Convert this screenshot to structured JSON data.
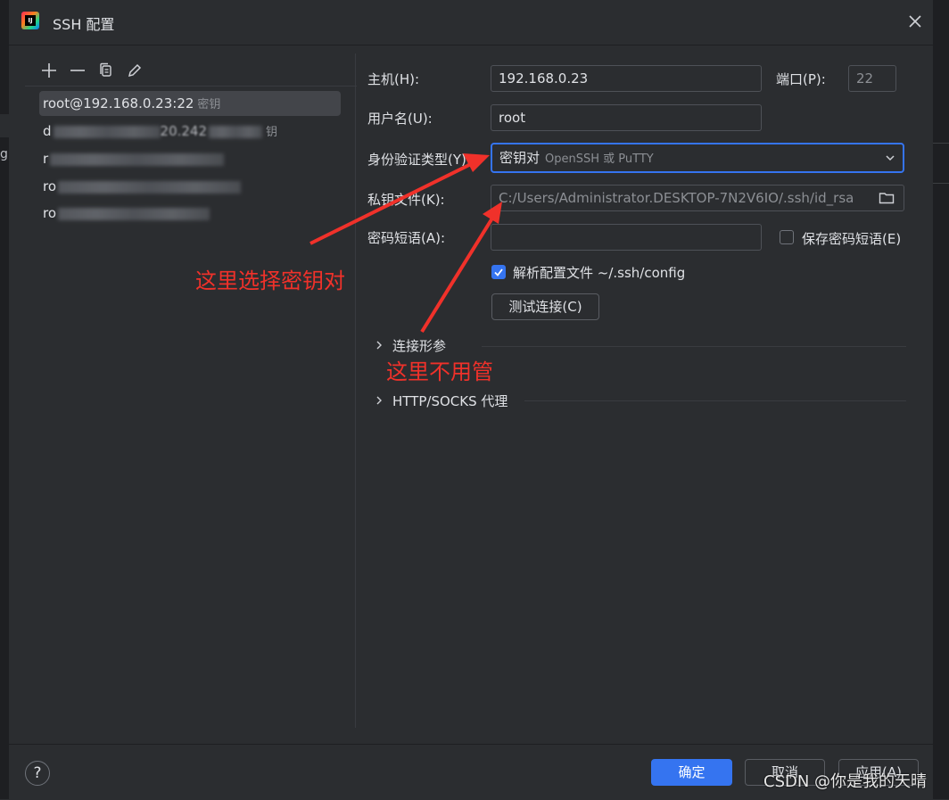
{
  "window": {
    "title": "SSH 配置",
    "close_icon": "close-icon"
  },
  "background": {
    "left_edge_char": "g"
  },
  "toolbar": {
    "icons": [
      "add-icon",
      "remove-icon",
      "copy-icon",
      "edit-icon"
    ]
  },
  "hosts": [
    {
      "text": "root@192.168.0.23:22",
      "hint": "密钥",
      "selected": true
    },
    {
      "text": "d",
      "blurred_tail": "20.242",
      "hint": "钥"
    },
    {
      "text": "r"
    },
    {
      "text": "ro"
    },
    {
      "text": "ro"
    }
  ],
  "form": {
    "host_label": "主机(H):",
    "host_value": "192.168.0.23",
    "port_label": "端口(P):",
    "port_value": "22",
    "user_label": "用户名(U):",
    "user_value": "root",
    "auth_label": "身份验证类型(Y):",
    "auth_value": "密钥对",
    "auth_sub": "OpenSSH 或 PuTTY",
    "keyfile_label": "私钥文件(K):",
    "keyfile_value": "C:/Users/Administrator.DESKTOP-7N2V6IO/.ssh/id_rsa",
    "passphrase_label": "密码短语(A):",
    "passphrase_value": "",
    "save_passphrase_label": "保存密码短语(E)",
    "save_passphrase_checked": false,
    "parse_config_label": "解析配置文件 ~/.ssh/config",
    "parse_config_checked": true,
    "test_button": "测试连接(C)"
  },
  "sections": {
    "connection_params": "连接形参",
    "proxy": "HTTP/SOCKS 代理"
  },
  "annotations": {
    "note1": "这里选择密钥对",
    "note2": "这里不用管",
    "color": "#f0312a"
  },
  "footer": {
    "help": "?",
    "ok": "确定",
    "cancel": "取消",
    "apply": "应用(A)"
  },
  "watermark": "CSDN @你是我的天晴",
  "colors": {
    "accent": "#3574f0",
    "background": "#2b2d30"
  }
}
